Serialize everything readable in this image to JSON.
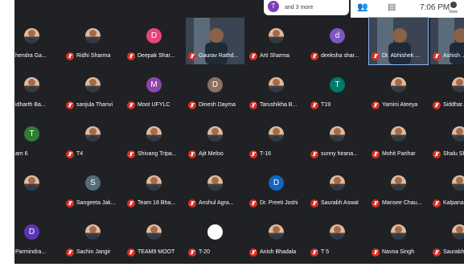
{
  "notification": {
    "avatar_letter": "T",
    "text": "and 3 more"
  },
  "topbar": {
    "people_icon": "people-icon",
    "chat_icon": "chat-icon",
    "time": "7:06 PM",
    "view_label": "View"
  },
  "colors": {
    "background": "#202124",
    "mic_muted": "#d93025",
    "speaking_border": "#8ab4f8"
  },
  "participants": [
    {
      "name": "hendra Ga...",
      "kind": "photo"
    },
    {
      "name": "Ridhi Sharma",
      "kind": "photo"
    },
    {
      "name": "Deepak Shar...",
      "kind": "letter",
      "letter": "D",
      "color": "#e8447a"
    },
    {
      "name": "Gaurav Rathd...",
      "kind": "video"
    },
    {
      "name": "Arti Sharma",
      "kind": "photo"
    },
    {
      "name": "deeksha shar...",
      "kind": "letter",
      "letter": "d",
      "color": "#7e57c2"
    },
    {
      "name": "Dr. Abhishek ...",
      "kind": "video",
      "speaking": true
    },
    {
      "name": "Ashish ...",
      "kind": "video"
    },
    {
      "name": "idharth Ba...",
      "kind": "photo"
    },
    {
      "name": "sanjula Thanvi",
      "kind": "photo"
    },
    {
      "name": "Moot UFYLC",
      "kind": "letter",
      "letter": "M",
      "color": "#8e44ad"
    },
    {
      "name": "Dinesh Dayma",
      "kind": "letter",
      "letter": "D",
      "color": "#8d6e63"
    },
    {
      "name": "Tarushikha B...",
      "kind": "photo"
    },
    {
      "name": "T19",
      "kind": "letter",
      "letter": "T",
      "color": "#00796b"
    },
    {
      "name": "Yamini Ateeya",
      "kind": "photo"
    },
    {
      "name": "Siddhar...",
      "kind": "photo"
    },
    {
      "name": "am 6",
      "kind": "letter",
      "letter": "T",
      "color": "#2e7d32"
    },
    {
      "name": "T4",
      "kind": "photo"
    },
    {
      "name": "Shivang Tripa...",
      "kind": "photo"
    },
    {
      "name": "Ajit Meloo",
      "kind": "photo"
    },
    {
      "name": "T-16",
      "kind": "photo"
    },
    {
      "name": "sunny hirana...",
      "kind": "photo"
    },
    {
      "name": "Mohit Parihar",
      "kind": "photo"
    },
    {
      "name": "Shalu Sh...",
      "kind": "photo"
    },
    {
      "name": "",
      "kind": "photo"
    },
    {
      "name": "Sangeeta Jak...",
      "kind": "letter",
      "letter": "S",
      "color": "#546e7a"
    },
    {
      "name": "Team 18 Bha...",
      "kind": "photo"
    },
    {
      "name": "Anshul Agra...",
      "kind": "photo"
    },
    {
      "name": "Dr. Preeti Joshi",
      "kind": "letter",
      "letter": "D",
      "color": "#1565c0"
    },
    {
      "name": "Saurabh Aswal",
      "kind": "photo"
    },
    {
      "name": "Mansee Chau...",
      "kind": "photo"
    },
    {
      "name": "Kalpana...",
      "kind": "photo"
    },
    {
      "name": "Parmindra...",
      "kind": "letter",
      "letter": "D",
      "color": "#5e35b1"
    },
    {
      "name": "Sachin Jangir",
      "kind": "photo"
    },
    {
      "name": "TEAM9 MOOT",
      "kind": "photo"
    },
    {
      "name": "T-20",
      "kind": "blank"
    },
    {
      "name": "Anish Bhadala",
      "kind": "photo"
    },
    {
      "name": "T 5",
      "kind": "photo"
    },
    {
      "name": "Navna Singh",
      "kind": "photo"
    },
    {
      "name": "Saurabh...",
      "kind": "photo"
    }
  ]
}
